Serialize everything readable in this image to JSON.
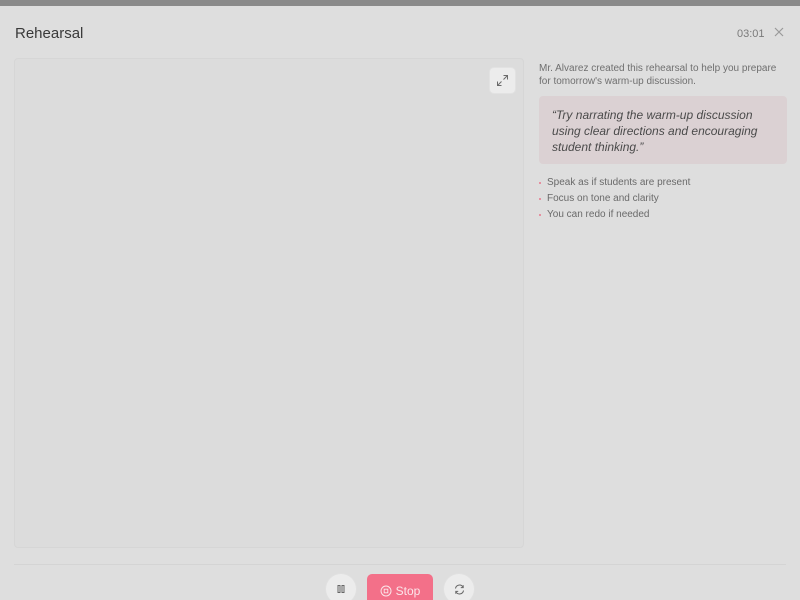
{
  "header": {
    "title": "Rehearsal",
    "timer": "03:01"
  },
  "stage": {
    "expand_icon": "expand-icon"
  },
  "sidebar": {
    "intro": "Mr. Alvarez created this rehearsal to help you prepare for tomorrow's warm-up discussion.",
    "quote": "“Try narrating the warm-up discussion using clear directions and encouraging student thinking.”",
    "tips": [
      "Speak as if students are present",
      "Focus on tone and clarity",
      "You can redo if needed"
    ]
  },
  "controls": {
    "stop_label": "Stop"
  },
  "colors": {
    "accent": "#f37089",
    "quote_bg": "#dbd1d3",
    "background": "#dedede"
  }
}
